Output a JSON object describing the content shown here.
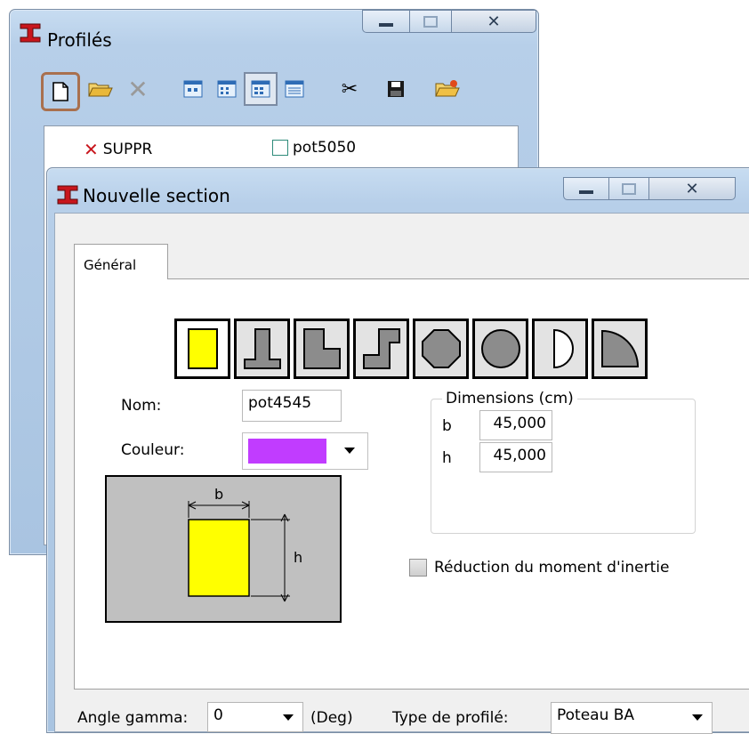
{
  "profiles_window": {
    "title": "Profilés",
    "toolbar": [
      {
        "name": "new-icon",
        "glyph": "🗋"
      },
      {
        "name": "open-folder-icon",
        "glyph": "📂"
      },
      {
        "name": "delete-icon",
        "glyph": "✕"
      },
      {
        "name": "view-large-icons-icon",
        "glyph": "▣"
      },
      {
        "name": "view-small-icons-icon",
        "glyph": "▤"
      },
      {
        "name": "view-list-icon",
        "glyph": "▦"
      },
      {
        "name": "view-details-icon",
        "glyph": "▥"
      },
      {
        "name": "cut-icon",
        "glyph": "✂"
      },
      {
        "name": "save-icon",
        "glyph": "💾"
      },
      {
        "name": "export-icon",
        "glyph": "📂"
      }
    ],
    "list_items": [
      {
        "label": "SUPPR",
        "icon": "red-x-icon"
      },
      {
        "label": "pot5050",
        "icon": "section-icon"
      }
    ]
  },
  "section_window": {
    "title": "Nouvelle section",
    "tab_label": "Général",
    "shapes": [
      "rectangle-section",
      "t-section",
      "l-section",
      "z-section",
      "octagon-section",
      "circle-section",
      "half-circle-section",
      "quarter-circle-section"
    ],
    "name_label": "Nom:",
    "name_value": "pot4545",
    "color_label": "Couleur:",
    "color_value": "#c13cff",
    "preview": {
      "b_label": "b",
      "h_label": "h",
      "fill": "#ffff00"
    },
    "dimensions_legend": "Dimensions (cm)",
    "dimensions": [
      {
        "label": "b",
        "value": "45,000"
      },
      {
        "label": "h",
        "value": "45,000"
      }
    ],
    "reduction_label": "Réduction du moment d'inertie",
    "angle_label": "Angle gamma:",
    "angle_value": "0",
    "angle_unit": "(Deg)",
    "profile_type_label": "Type de profilé:",
    "profile_type_value": "Poteau BA"
  },
  "colors": {
    "title_icon_red": "#c8161d",
    "selection_border": "#a9704e"
  }
}
